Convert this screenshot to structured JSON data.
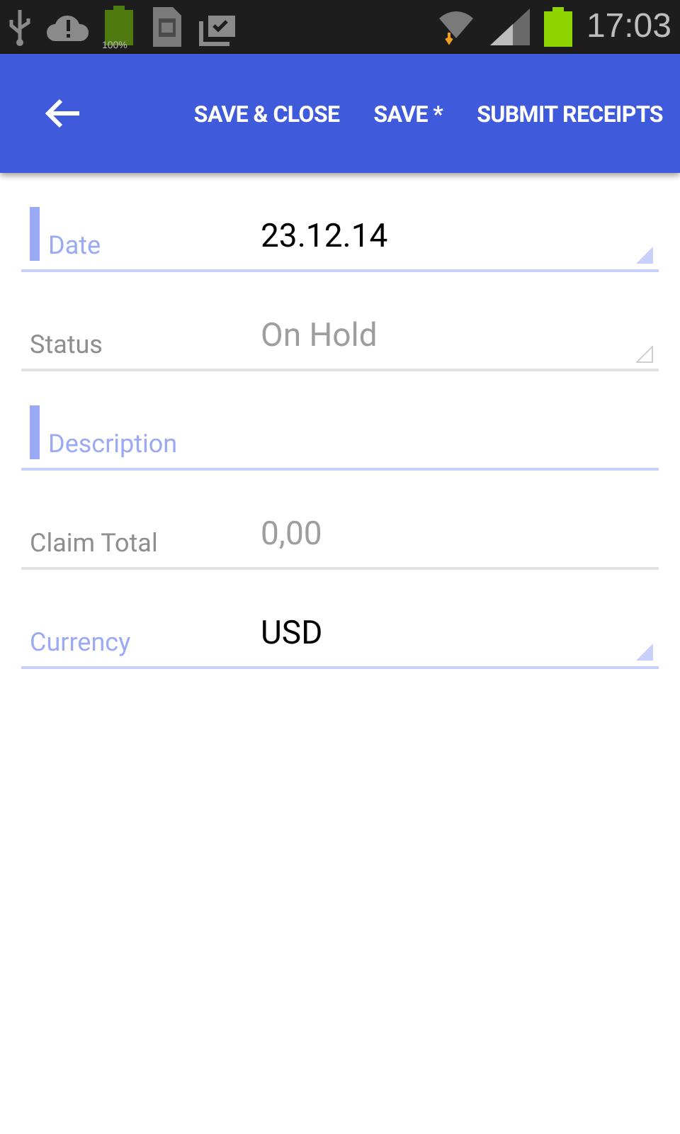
{
  "status_bar": {
    "battery_label": "100%",
    "time": "17:03"
  },
  "app_bar": {
    "actions": [
      {
        "label": "SAVE & CLOSE"
      },
      {
        "label": "SAVE *"
      },
      {
        "label": "SUBMIT RECEIPTS"
      }
    ]
  },
  "fields": [
    {
      "label": "Date",
      "kind": "dropdown",
      "value": "23.12.14",
      "required": true,
      "disabled": false
    },
    {
      "label": "Status",
      "kind": "dropdown",
      "value": "On Hold",
      "required": false,
      "disabled": true
    },
    {
      "label": "Description",
      "kind": "text",
      "required": true,
      "disabled": false
    },
    {
      "label": "Claim Total",
      "kind": "text",
      "value": "0,00",
      "required": false,
      "disabled": true
    },
    {
      "label": "Currency",
      "kind": "dropdown",
      "value": "USD",
      "required": false,
      "disabled": false
    }
  ]
}
